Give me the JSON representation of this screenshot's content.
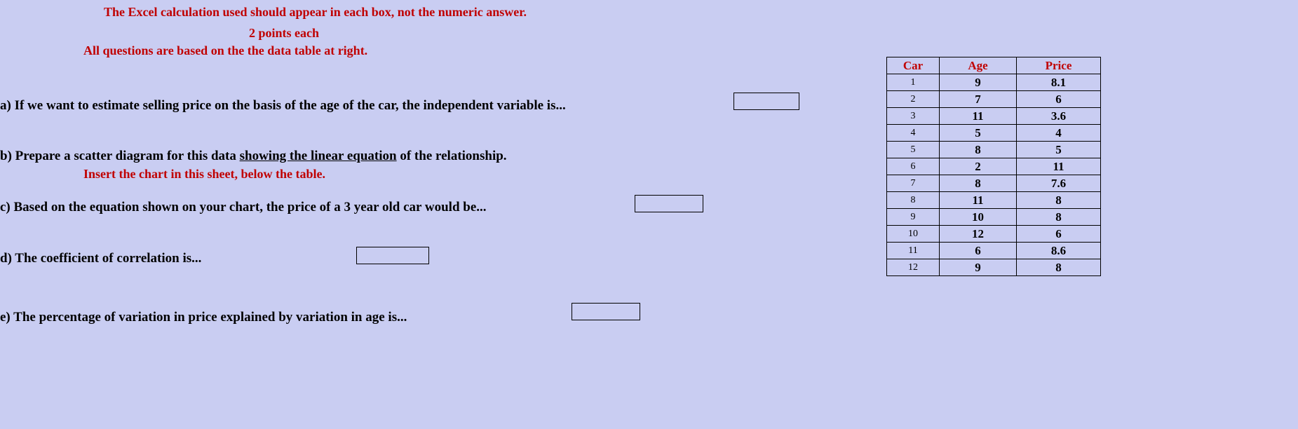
{
  "instructions": {
    "top": "The Excel calculation used should appear in each box, not the numeric answer.",
    "points": "2 points each",
    "basedOn": "All questions are based on the the data table at right."
  },
  "questions": {
    "a": "a)  If we want to estimate selling price on the basis of the age of the car, the independent variable is...",
    "b_prefix": "b)  Prepare a scatter diagram for this data ",
    "b_underlined": "showing the linear equation",
    "b_suffix": " of the relationship.",
    "b_sub": "Insert the chart in this sheet, below the table.",
    "c": "c)  Based  on the equation shown on your chart, the price of a 3 year old car would be...",
    "d": "d)  The coefficient of correlation is...",
    "e": "e)  The percentage of variation in price explained by variation in age is..."
  },
  "table": {
    "headers": {
      "car": "Car",
      "age": "Age",
      "price": "Price"
    },
    "rows": [
      {
        "car": "1",
        "age": "9",
        "price": "8.1"
      },
      {
        "car": "2",
        "age": "7",
        "price": "6"
      },
      {
        "car": "3",
        "age": "11",
        "price": "3.6"
      },
      {
        "car": "4",
        "age": "5",
        "price": "4"
      },
      {
        "car": "5",
        "age": "8",
        "price": "5"
      },
      {
        "car": "6",
        "age": "2",
        "price": "11"
      },
      {
        "car": "7",
        "age": "8",
        "price": "7.6"
      },
      {
        "car": "8",
        "age": "11",
        "price": "8"
      },
      {
        "car": "9",
        "age": "10",
        "price": "8"
      },
      {
        "car": "10",
        "age": "12",
        "price": "6"
      },
      {
        "car": "11",
        "age": "6",
        "price": "8.6"
      },
      {
        "car": "12",
        "age": "9",
        "price": "8"
      }
    ]
  }
}
